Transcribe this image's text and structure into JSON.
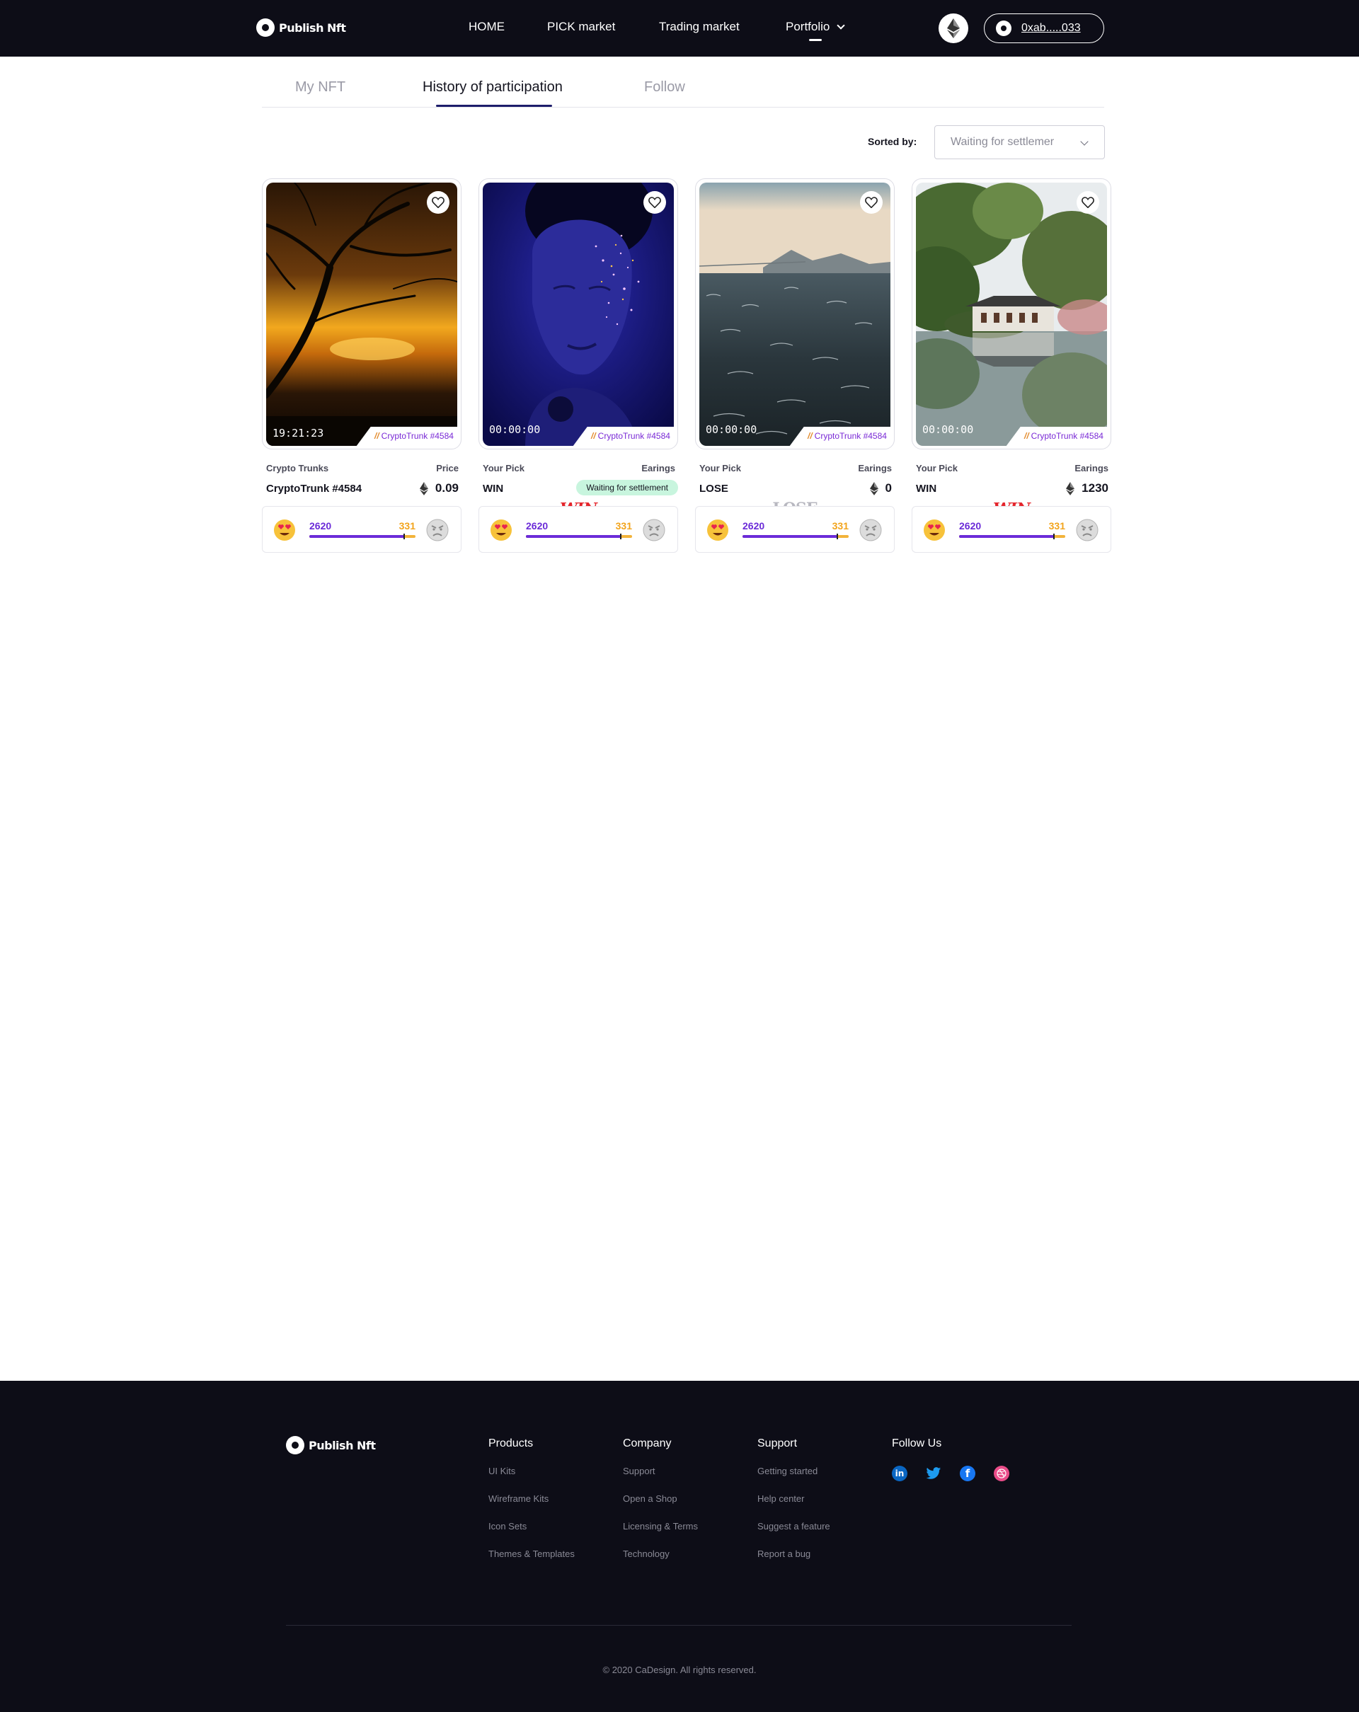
{
  "header": {
    "logo_text": "Publish Nft",
    "nav": [
      "HOME",
      "PICK market",
      "Trading market",
      "Portfolio"
    ],
    "wallet_address": "0xab.....033"
  },
  "tabs": [
    "My NFT",
    "History of participation",
    "Follow"
  ],
  "active_tab": "History of participation",
  "sort": {
    "label": "Sorted by:",
    "value": "Waiting for settlemer"
  },
  "cards": [
    {
      "time": "19:21:23",
      "badge": "CryptoTrunk #4584",
      "left_label": "Crypto Trunks",
      "right_label": "Price",
      "left_value": "CryptoTrunk #4584",
      "right_value": "0.09",
      "status_pill": "",
      "stamp": "",
      "votes_love": "2620",
      "votes_angry": "331",
      "love_share": 0.89
    },
    {
      "time": "00:00:00",
      "badge": "CryptoTrunk #4584",
      "left_label": "Your Pick",
      "right_label": "Earings",
      "left_value": "WIN",
      "right_value": "",
      "status_pill": "Waiting for settlement",
      "stamp": "WIN",
      "votes_love": "2620",
      "votes_angry": "331",
      "love_share": 0.89
    },
    {
      "time": "00:00:00",
      "badge": "CryptoTrunk #4584",
      "left_label": "Your Pick",
      "right_label": "Earings",
      "left_value": "LOSE",
      "right_value": "0",
      "status_pill": "",
      "stamp": "LOSE",
      "votes_love": "2620",
      "votes_angry": "331",
      "love_share": 0.89
    },
    {
      "time": "00:00:00",
      "badge": "CryptoTrunk #4584",
      "left_label": "Your Pick",
      "right_label": "Earings",
      "left_value": "WIN",
      "right_value": "1230",
      "status_pill": "",
      "stamp": "WIN",
      "votes_love": "2620",
      "votes_angry": "331",
      "love_share": 0.89
    }
  ],
  "footer": {
    "logo_text": "Publish Nft",
    "columns": [
      {
        "title": "Products",
        "links": [
          "UI Kits",
          "Wireframe Kits",
          "Icon Sets",
          "Themes & Templates"
        ]
      },
      {
        "title": "Company",
        "links": [
          "Support",
          "Open a Shop",
          "Licensing & Terms",
          "Technology"
        ]
      },
      {
        "title": "Support",
        "links": [
          "Getting started",
          "Help center",
          "Suggest a feature",
          "Report a bug"
        ]
      }
    ],
    "follow_title": "Follow Us",
    "social_icons": [
      "linkedin-icon",
      "twitter-icon",
      "facebook-icon",
      "dribbble-icon"
    ],
    "copyright": "© 2020 CaDesign. All rights reserved."
  },
  "colors": {
    "header_bg": "#0d0d17",
    "accent_purple": "#6b2bd8",
    "accent_orange": "#f2a41c",
    "win_red": "#e4252c",
    "pill_green": "#c8f5de"
  }
}
